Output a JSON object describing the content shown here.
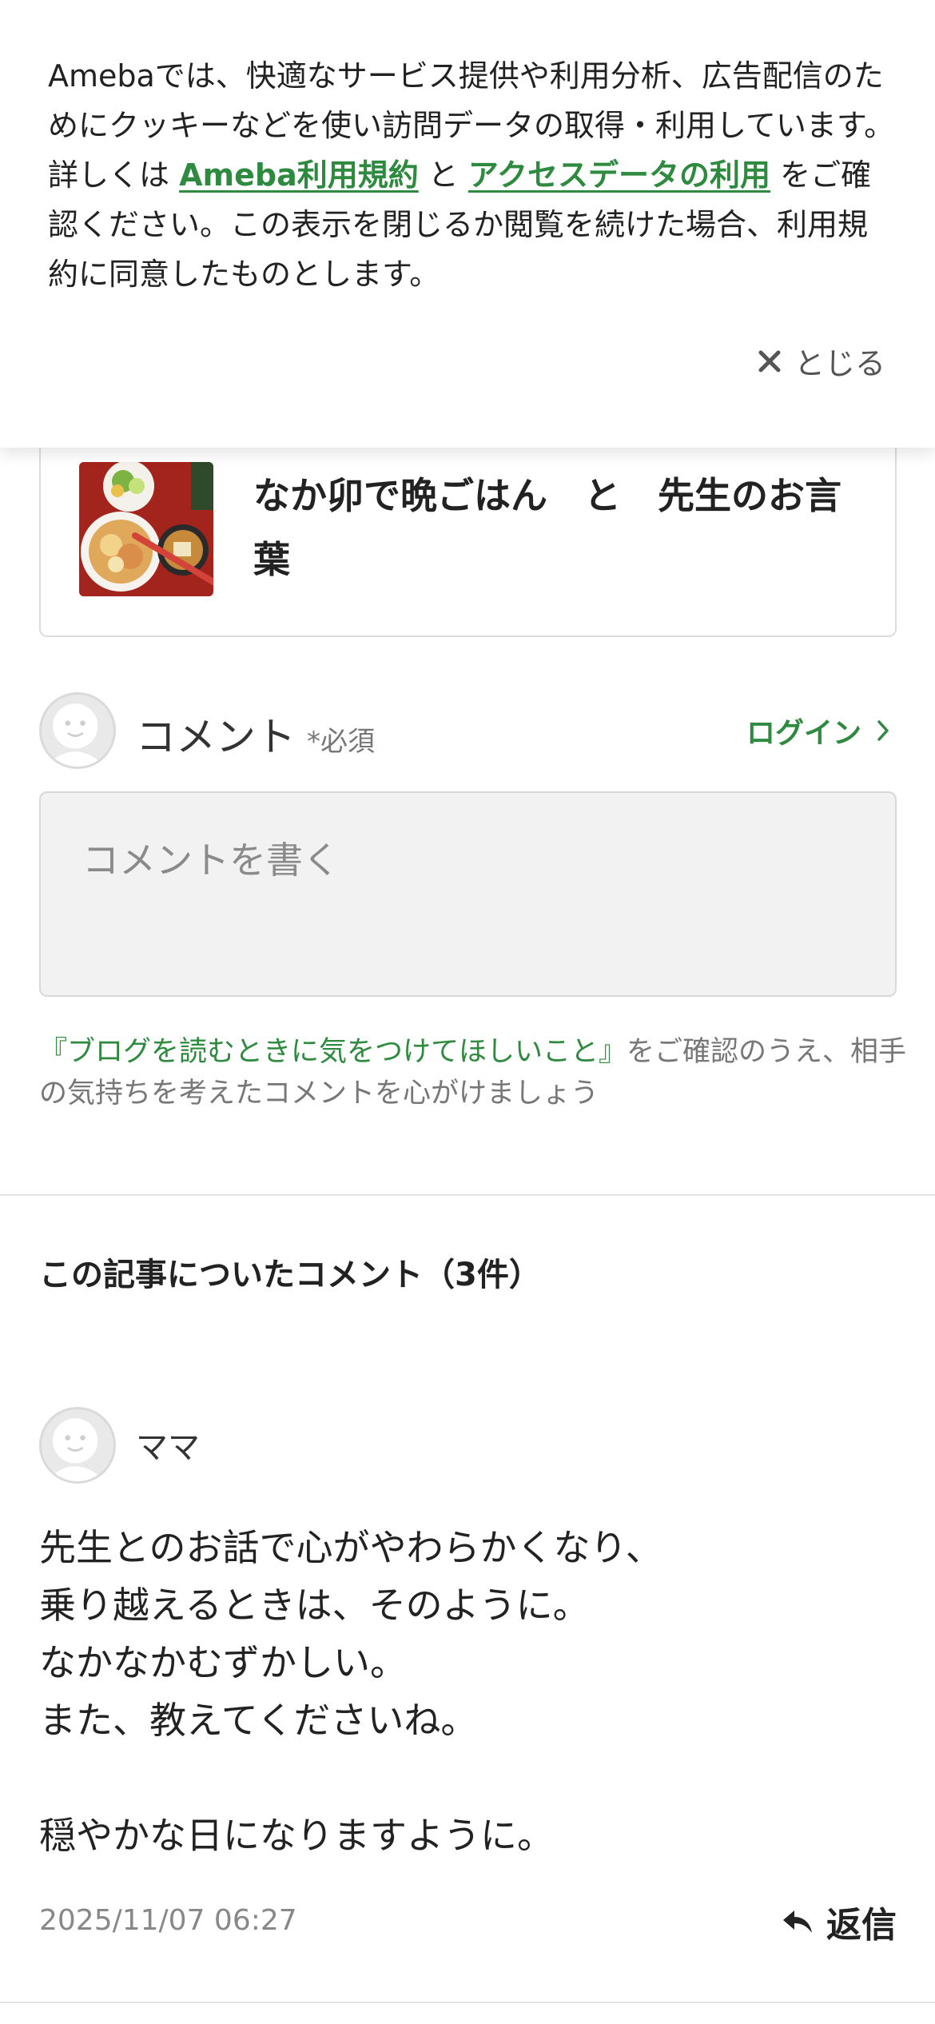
{
  "cookie_banner": {
    "text_part1": "Amebaでは、快適なサービス提供や利用分析、広告配信のためにクッキーなどを使い訪問データの取得・利用しています。詳しくは ",
    "link_terms": "Ameba利用規約",
    "text_part2": " と ",
    "link_access_data": "アクセスデータの利用",
    "text_part3": " をご確認ください。この表示を閉じるか閲覧を続けた場合、利用規約に同意したものとします。",
    "close_label": "とじる",
    "close_icon": "close-icon",
    "link_color": "#2d8a3e"
  },
  "article_card": {
    "title": "なか卯で晩ごはん　と　先生のお言葉",
    "thumbnail_icon": "food-photo-thumbnail"
  },
  "comment_form": {
    "label": "コメント",
    "required": "*必須",
    "login_label": "ログイン",
    "placeholder": "コメントを書く",
    "guideline_link": "『ブログを読むときに気をつけてほしいこと』",
    "guideline_text": "をご確認のうえ、相手の気持ちを考えたコメントを心がけましょう"
  },
  "comments": {
    "heading": "この記事についたコメント（3件）",
    "items": [
      {
        "author": "ママ",
        "body": "先生とのお話で心がやわらかくなり、\n乗り越えるときは、そのように。\nなかなかむずかしい。\nまた、教えてくださいね。\n\n穏やかな日になりますように。",
        "date": "2025/11/07 06:27",
        "reply_label": "返信"
      }
    ]
  }
}
